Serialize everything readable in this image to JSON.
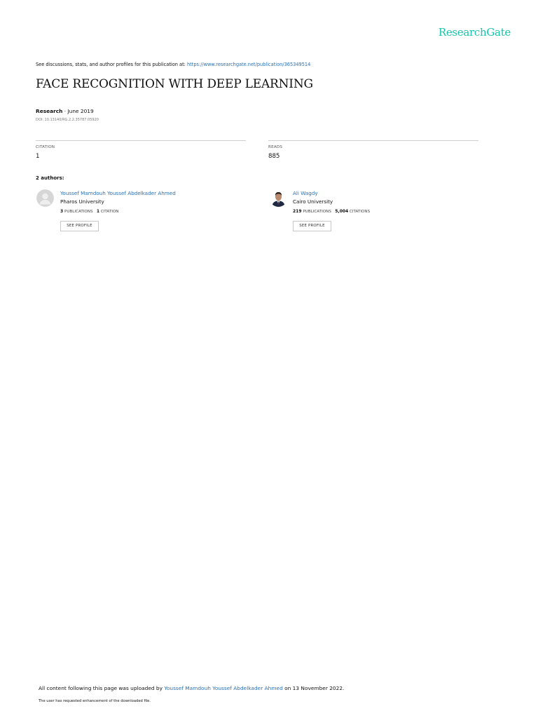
{
  "header": {
    "brand": "ResearchGate"
  },
  "discussion": {
    "prefix": "See discussions, stats, and author profiles for this publication at: ",
    "url": "https://www.researchgate.net/publication/365349514"
  },
  "publication": {
    "title": "FACE RECOGNITION WITH DEEP LEARNING",
    "type": "Research",
    "date_sep": " · ",
    "date": "June 2019",
    "doi": "DOI: 10.13140/RG.2.2.35787.05920"
  },
  "stats": {
    "citation_label": "CITATION",
    "citation_value": "1",
    "reads_label": "READS",
    "reads_value": "885"
  },
  "authors_heading": "2 authors:",
  "authors": [
    {
      "name": "Youssef Mamdouh Youssef Abdelkader Ahmed",
      "institution": "Pharos University",
      "publications_count": "3",
      "publications_label": "PUBLICATIONS",
      "citations_count": "1",
      "citations_label": "CITATION",
      "button": "SEE PROFILE"
    },
    {
      "name": "Ali Wagdy",
      "institution": "Cairo University",
      "publications_count": "219",
      "publications_label": "PUBLICATIONS",
      "citations_count": "5,004",
      "citations_label": "CITATIONS",
      "button": "SEE PROFILE"
    }
  ],
  "footer": {
    "upload_prefix": "All content following this page was uploaded by ",
    "uploader": "Youssef Mamdouh Youssef Abdelkader Ahmed",
    "upload_suffix": " on 13 November 2022.",
    "note": "The user has requested enhancement of the downloaded file."
  },
  "colors": {
    "brand": "#19c3a9",
    "link": "#2a6fb5"
  },
  "icons": {
    "author_1_avatar": "default-avatar-icon",
    "author_2_avatar": "profile-photo"
  }
}
